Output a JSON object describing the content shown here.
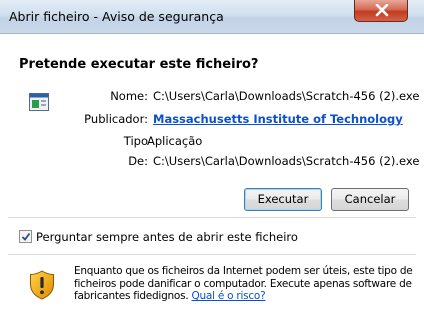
{
  "window": {
    "title": "Abrir ficheiro - Aviso de segurança"
  },
  "dialog": {
    "heading": "Pretende executar este ficheiro?",
    "fields": [
      {
        "label": "Nome:",
        "value": "C:\\Users\\Carla\\Downloads\\Scratch-456 (2).exe"
      },
      {
        "label": "Publicador:",
        "value": "Massachusetts Institute of Technology"
      },
      {
        "label": "Tipo",
        "value": "Aplicação"
      },
      {
        "label": "De:",
        "value": "C:\\Users\\Carla\\Downloads\\Scratch-456 (2).exe"
      }
    ],
    "run_label": "Executar",
    "cancel_label": "Cancelar",
    "checkbox": {
      "label": "Perguntar sempre antes de abrir este ficheiro",
      "checked": true
    },
    "warning": {
      "line1": "Enquanto que os ficheiros da Internet podem ser úteis, este tipo de",
      "line2": "ficheiros pode danificar o computador. Execute apenas software de",
      "line3": "fabricantes fidedignos.",
      "link": "Qual é o risco?"
    }
  },
  "colors": {
    "link": "#0b52c8",
    "close_button": "#c23b1e",
    "title_bar": "#c9d8ea"
  },
  "icons": [
    "close-icon",
    "application-icon",
    "checkmark-icon",
    "shield-icon"
  ]
}
